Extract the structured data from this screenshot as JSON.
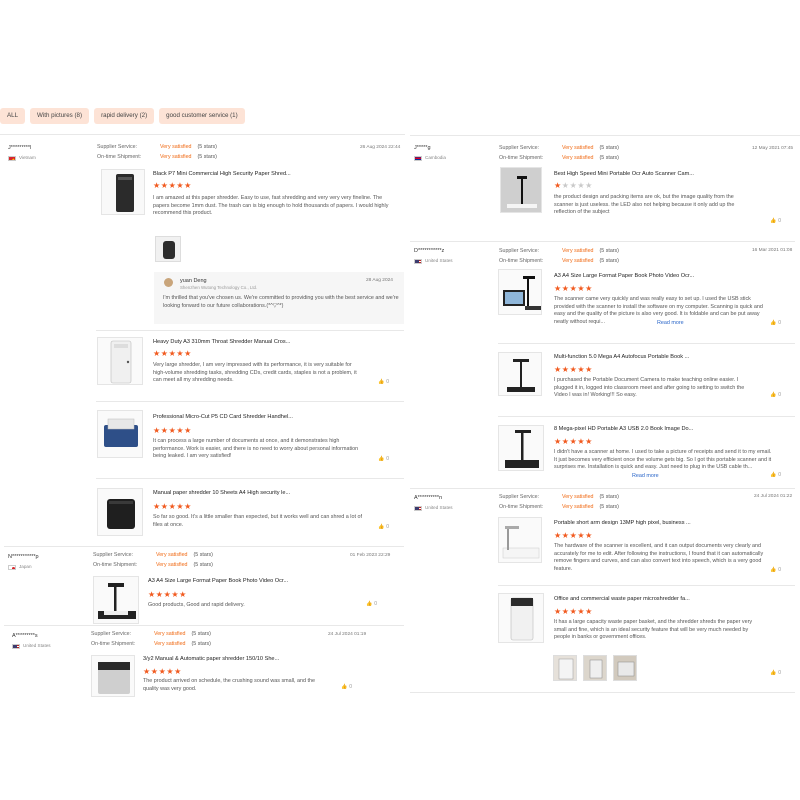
{
  "filters": [
    {
      "label": "ALL"
    },
    {
      "label": "With pictures (8)"
    },
    {
      "label": "rapid delivery (2)"
    },
    {
      "label": "good customer service (1)"
    }
  ],
  "labels": {
    "supplier_service": "Supplier Service:",
    "ontime_shipment": "On-time Shipment:",
    "very_satisfied": "Very satisfied",
    "five_stars": "(5 stars)",
    "helpful_count": "0",
    "read_more": "Read more"
  },
  "left": {
    "r1": {
      "user": "J*********l",
      "country": "Vietnam",
      "date": "26 Aug 2024 22:44",
      "product": "Black P7 Mini Commercial High Security Paper Shred...",
      "stars": 5,
      "text": "I am amazed at this paper shredder. Easy to use, fast shredding and very very very fineline. The papers become 1mm dust. The trash can is big enough to hold thousands of papers.\nI would highly recommend this product.",
      "reply": {
        "name": "yuan Deng",
        "company": "Shenzhen Wutong Technology Co., Ltd.",
        "date": "28 Aug 2024",
        "text": "I'm thrilled that you've chosen us. We're committed to providing you with the best service and we're looking forward to our future collaborations.(*^▽^*)"
      }
    },
    "r2": {
      "product": "Heavy Duty A3 310mm Throat Shredder Manual Cros...",
      "stars": 5,
      "text": "Very large shredder, I am very impressed with its performance, it is very suitable for high-volume shredding tasks, shredding CDs, credit cards, staples is not a problem, it can meet all my shredding needs."
    },
    "r3": {
      "product": "Professional Micro-Cut P5 CD Card Shredder Handhel...",
      "stars": 5,
      "text": "It can process a large number of documents at once, and it demonstrates high performance. Work is easier, and there is no need to worry about personal information being leaked. I am very satisfied!"
    },
    "r4": {
      "product": "Manual paper shredder 10 Sheets A4 High security le...",
      "stars": 5,
      "text": "So far so good. It's a little smaller than expected, but it works well and can shred a lot of files at once."
    },
    "r5": {
      "user": "N***********p",
      "country": "Japan",
      "date": "01 Feb 2023 22:29",
      "product": "A3 A4 Size Large Format Paper Book Photo Video Ocr...",
      "stars": 5,
      "text": "Good products, Good and rapid delivery."
    },
    "r6": {
      "user": "A*********s",
      "country": "United States",
      "date": "24 Jul 2024 01:19",
      "product": "3/y2 Manual & Automatic paper shredder 150/10 She...",
      "stars": 5,
      "text": "The product arrived on schedule, the crushing sound was small, and the quality was very good."
    }
  },
  "right": {
    "r1": {
      "user": "J*****g",
      "country": "Cambodia",
      "date": "12 May 2021 07:45",
      "product": "Best High Speed Mini Portable Ocr Auto Scanner Cam...",
      "stars": 1,
      "text": "the product design and packing items are ok, but the image quality from the scanner is just useless. the LED also not helping because it only add up the reflection of the subject"
    },
    "r2": {
      "user": "D***********z",
      "country": "United States",
      "date": "16 Mar 2021 01:08",
      "product": "A3 A4 Size Large Format Paper Book Photo Video Ocr...",
      "stars": 5,
      "text": "The scanner came very quickly and was really easy to set up. I used the USB stick provided with the scanner to install the software on my computer. Scanning is quick and easy and the quality of the picture is also very good. It is foldable and can be put away neatly without requi..."
    },
    "r3": {
      "product": "Multi-function 5.0 Mega A4 Autofocus Portable Book ...",
      "stars": 5,
      "text": "I purchased the Portable Document Camera to make teaching online easier. I plugged it in, logged into classroom meet and after going to setting to switch the Video I was in! Working!!! So easy."
    },
    "r4": {
      "product": "8 Mega-pixel HD Portable A3 USB 2.0 Book Image Do...",
      "stars": 5,
      "text": "I didn't have a scanner at home. I used to take a picture of receipts and send it to my email. It just becomes very efficient once the volume gets big. So I got this portable scanner and it surprises me. Installation is quick and easy. Just need to plug in the USB cable th..."
    },
    "r5": {
      "user": "A**********n",
      "country": "United States",
      "date": "24 Jul 2024 01:22",
      "product": "Portable short arm design 13MP high pixel, business ...",
      "stars": 5,
      "text": "The hardware of the scanner is excellent, and it can output documents very clearly and accurately for me to edit. After following the instructions, I found that it can automatically remove fingers and curves, and can also convert text into speech, which is a very good feature."
    },
    "r6": {
      "product": "Office and commercial waste paper microshredder fa...",
      "stars": 5,
      "text": "It has a large capacity waste paper basket, and the shredder shreds the paper very small and fine, which is an ideal security feature that will be very much needed by people in banks or government offices."
    }
  },
  "colors": {
    "accent": "#f06a14",
    "star": "#f15a1f",
    "chip_bg": "#fde3d6",
    "link": "#2a66c9"
  },
  "icons": [
    "thumbs-up-icon",
    "star-icon",
    "flag-icon",
    "avatar-icon"
  ]
}
